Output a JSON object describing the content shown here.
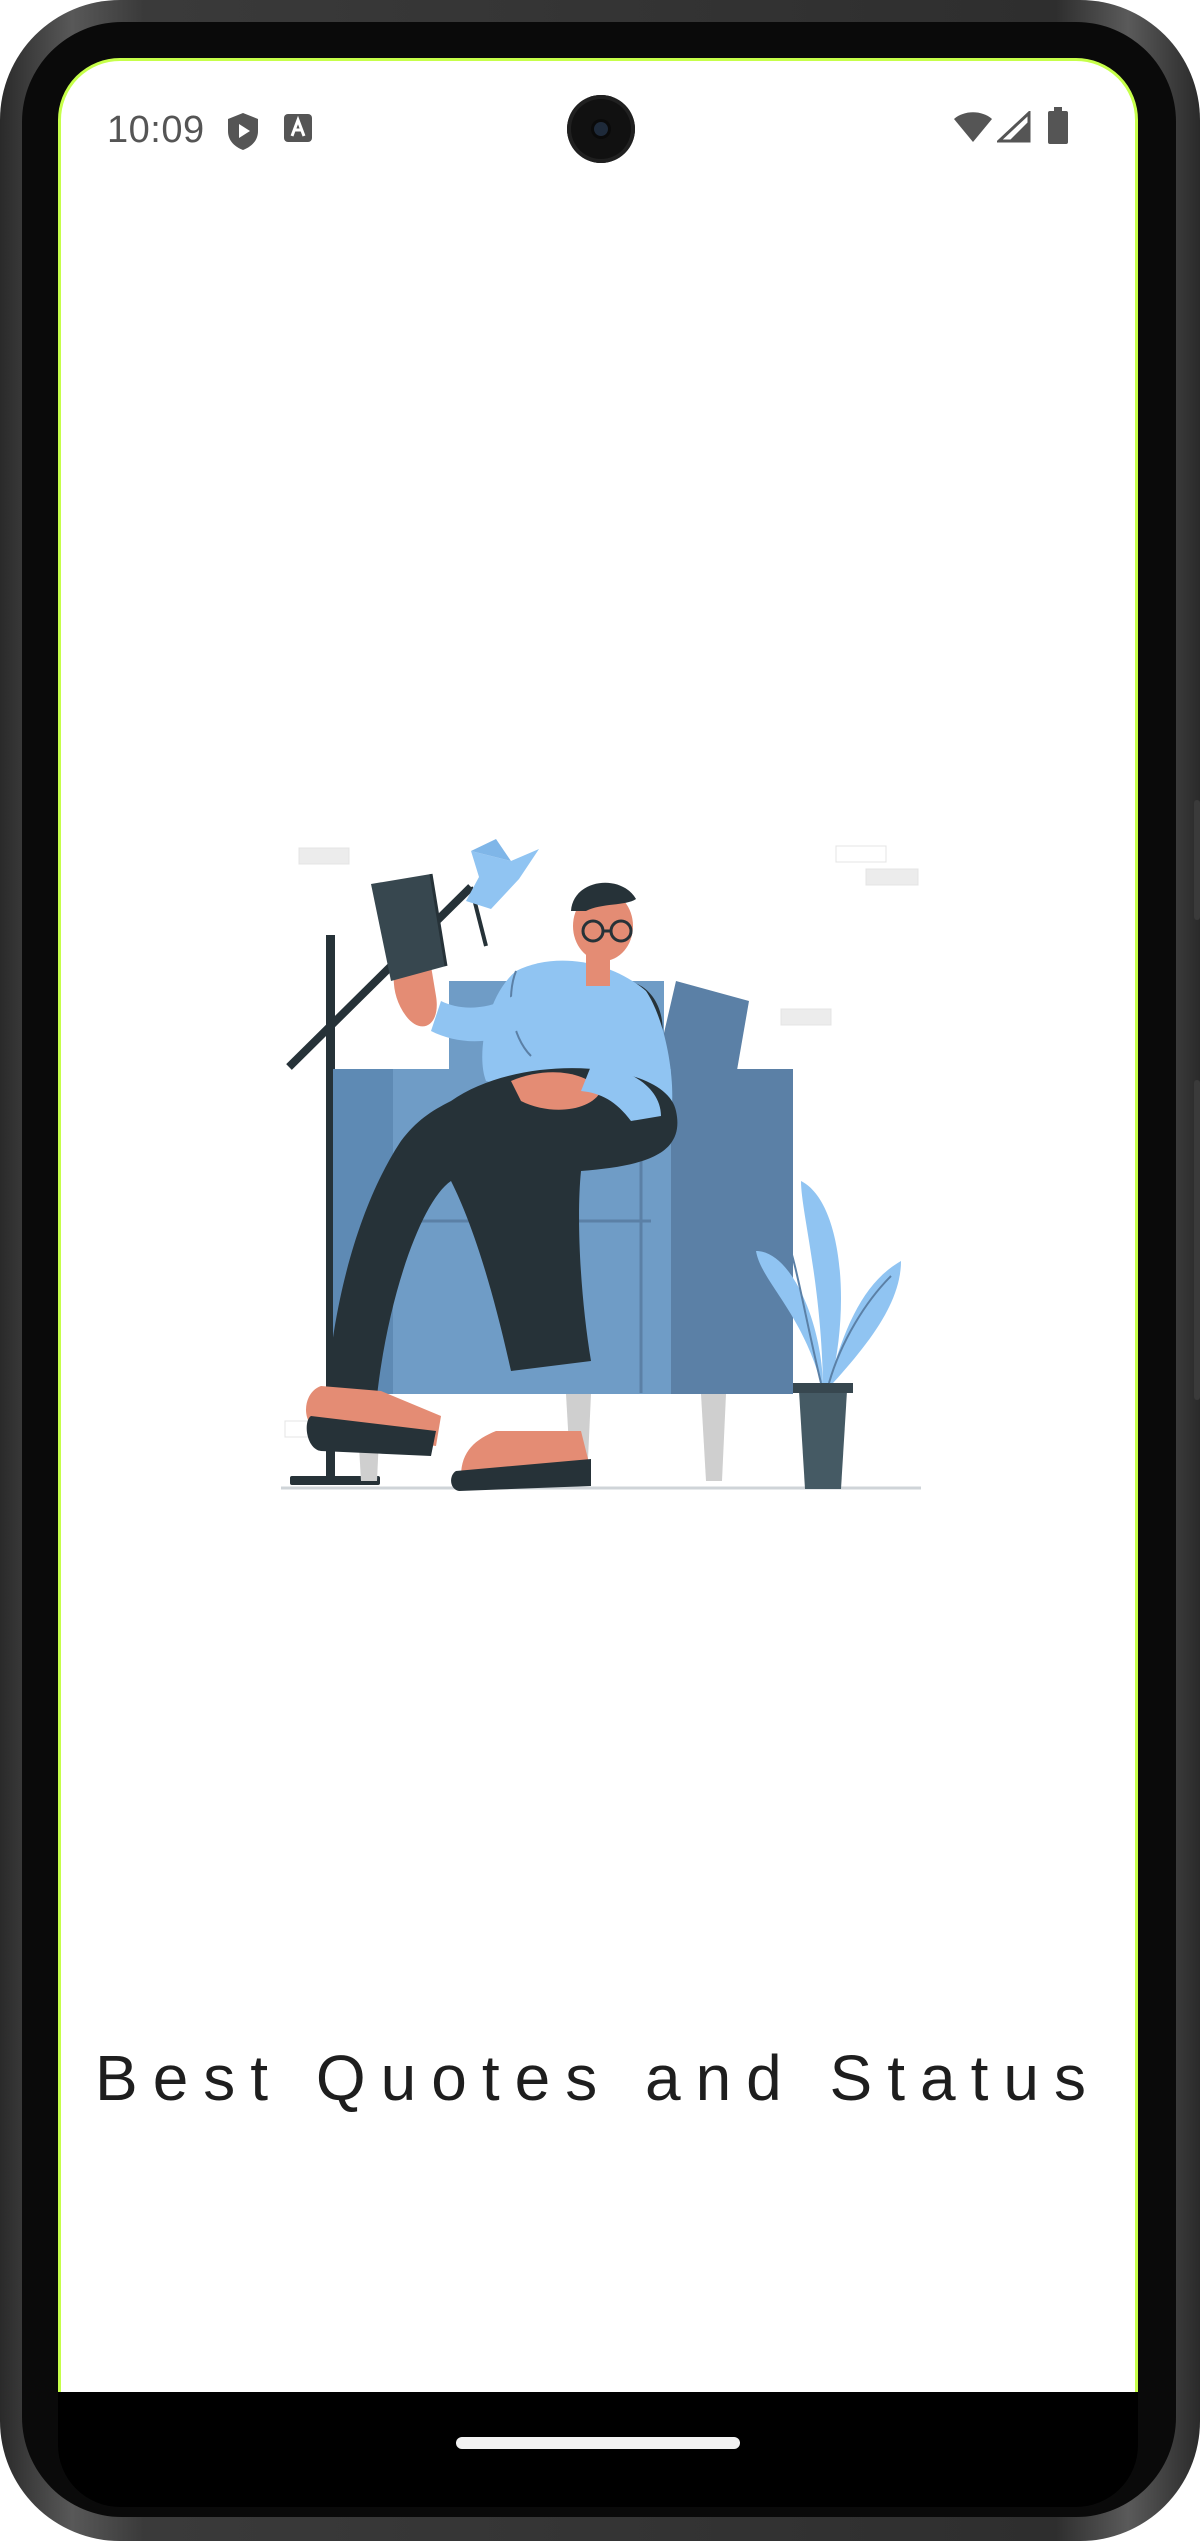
{
  "status_bar": {
    "time": "10:09",
    "left_icons": [
      "shield-play-icon",
      "text-a-icon"
    ],
    "right_icons": [
      "wifi-icon",
      "signal-icon",
      "battery-icon"
    ]
  },
  "splash": {
    "illustration": "woman-reading-in-armchair-illustration",
    "title": "Best Quotes and Status"
  },
  "colors": {
    "screen_border": "#c6ff4a",
    "chair": "#6f9cc6",
    "chair_dark": "#5b80a6",
    "lamp_shade": "#90c4f2",
    "plant": "#90c4f2",
    "outline_dark": "#263238",
    "skin": "#e48c74"
  }
}
